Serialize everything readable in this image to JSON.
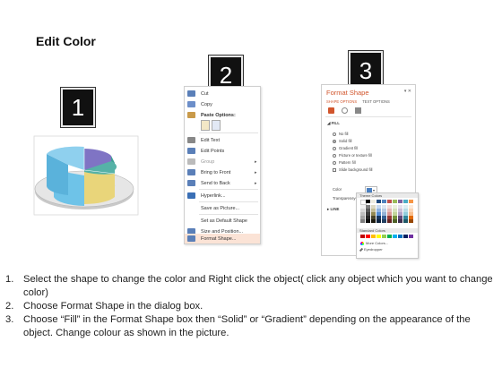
{
  "title": "Edit Color",
  "steps": [
    "1",
    "2",
    "3"
  ],
  "context_menu": {
    "items": [
      {
        "label": "Cut",
        "icon": "scissors-icon",
        "color": "#5a7fb8"
      },
      {
        "label": "Copy",
        "icon": "copy-icon",
        "color": "#6c8ec9"
      },
      {
        "label": "Paste Options:",
        "icon": "paste-icon",
        "color": "#c99a4a",
        "header": true
      },
      {
        "label": "",
        "icon": "",
        "color": ""
      },
      {
        "label": "Edit Text",
        "icon": "edit-text-icon",
        "color": "#888"
      },
      {
        "label": "Edit Points",
        "icon": "edit-points-icon",
        "color": "#5a7fb8"
      },
      {
        "label": "Group",
        "icon": "group-icon",
        "color": "#999",
        "arrow": true,
        "disabled": true
      },
      {
        "label": "Bring to Front",
        "icon": "bring-front-icon",
        "color": "#5a7fb8",
        "arrow": true
      },
      {
        "label": "Send to Back",
        "icon": "send-back-icon",
        "color": "#5a7fb8",
        "arrow": true
      },
      {
        "label": "Hyperlink...",
        "icon": "hyperlink-icon",
        "color": "#3a6fb5"
      },
      {
        "label": "Save as Picture...",
        "icon": "",
        "color": ""
      },
      {
        "label": "Set as Default Shape",
        "icon": "",
        "color": ""
      },
      {
        "label": "Size and Position...",
        "icon": "size-position-icon",
        "color": "#5a7fb8"
      },
      {
        "label": "Format Shape...",
        "icon": "format-shape-icon",
        "color": "#5a7fb8",
        "highlight": true
      }
    ]
  },
  "format_pane": {
    "title": "Format Shape",
    "tabs": [
      "SHAPE OPTIONS",
      "TEXT OPTIONS"
    ],
    "fill_section": "FILL",
    "fill_options": [
      "No fill",
      "Solid fill",
      "Gradient fill",
      "Picture or texture fill",
      "Pattern fill",
      "Slide background fill"
    ],
    "selected_fill": "Solid fill",
    "color_label": "Color",
    "transparency_label": "Transparency",
    "line_section": "LINE",
    "accent_color": "#d1552c"
  },
  "palette": {
    "theme_header": "Theme Colors",
    "standard_header": "Standard Colors",
    "more_colors": "More Colors...",
    "eyedropper": "Eyedropper",
    "theme_top": [
      "#ffffff",
      "#000000",
      "#eeece1",
      "#1f497d",
      "#4f81bd",
      "#c0504d",
      "#9bbb59",
      "#8064a2",
      "#4bacc6",
      "#f79646"
    ],
    "theme_shades": [
      [
        "#f2f2f2",
        "#7f7f7f",
        "#ddd9c3",
        "#c6d9f0",
        "#dbe5f1",
        "#f2dcdb",
        "#ebf1dd",
        "#e5e0ec",
        "#dbeef3",
        "#fdeada"
      ],
      [
        "#d8d8d8",
        "#595959",
        "#c4bd97",
        "#8db3e2",
        "#b8cce4",
        "#e5b9b7",
        "#d7e3bc",
        "#ccc1d9",
        "#b7dde8",
        "#fbd5b5"
      ],
      [
        "#bfbfbf",
        "#3f3f3f",
        "#938953",
        "#548dd4",
        "#95b3d7",
        "#d99694",
        "#c3d69b",
        "#b2a2c7",
        "#92cddc",
        "#fac08f"
      ],
      [
        "#a5a5a5",
        "#262626",
        "#494429",
        "#17365d",
        "#366092",
        "#953734",
        "#76923c",
        "#5f497a",
        "#31859b",
        "#e36c09"
      ],
      [
        "#7f7f7f",
        "#0c0c0c",
        "#1d1b10",
        "#0f243e",
        "#244061",
        "#632423",
        "#4f6128",
        "#3f3151",
        "#205867",
        "#974806"
      ]
    ],
    "standard": [
      "#c00000",
      "#ff0000",
      "#ffc000",
      "#ffff00",
      "#92d050",
      "#00b050",
      "#00b0f0",
      "#0070c0",
      "#002060",
      "#7030a0"
    ]
  },
  "instructions": [
    {
      "num": "1.",
      "text": "Select the shape to change the color and Right click the object( click any object which you want to change color)"
    },
    {
      "num": "2.",
      "text": "Choose Format Shape in the dialog box."
    },
    {
      "num": "3.",
      "text": "Choose “Fill” in the Format Shape box then “Solid” or “Gradient” depending on the appearance of the object. Change colour as shown in the picture."
    }
  ]
}
